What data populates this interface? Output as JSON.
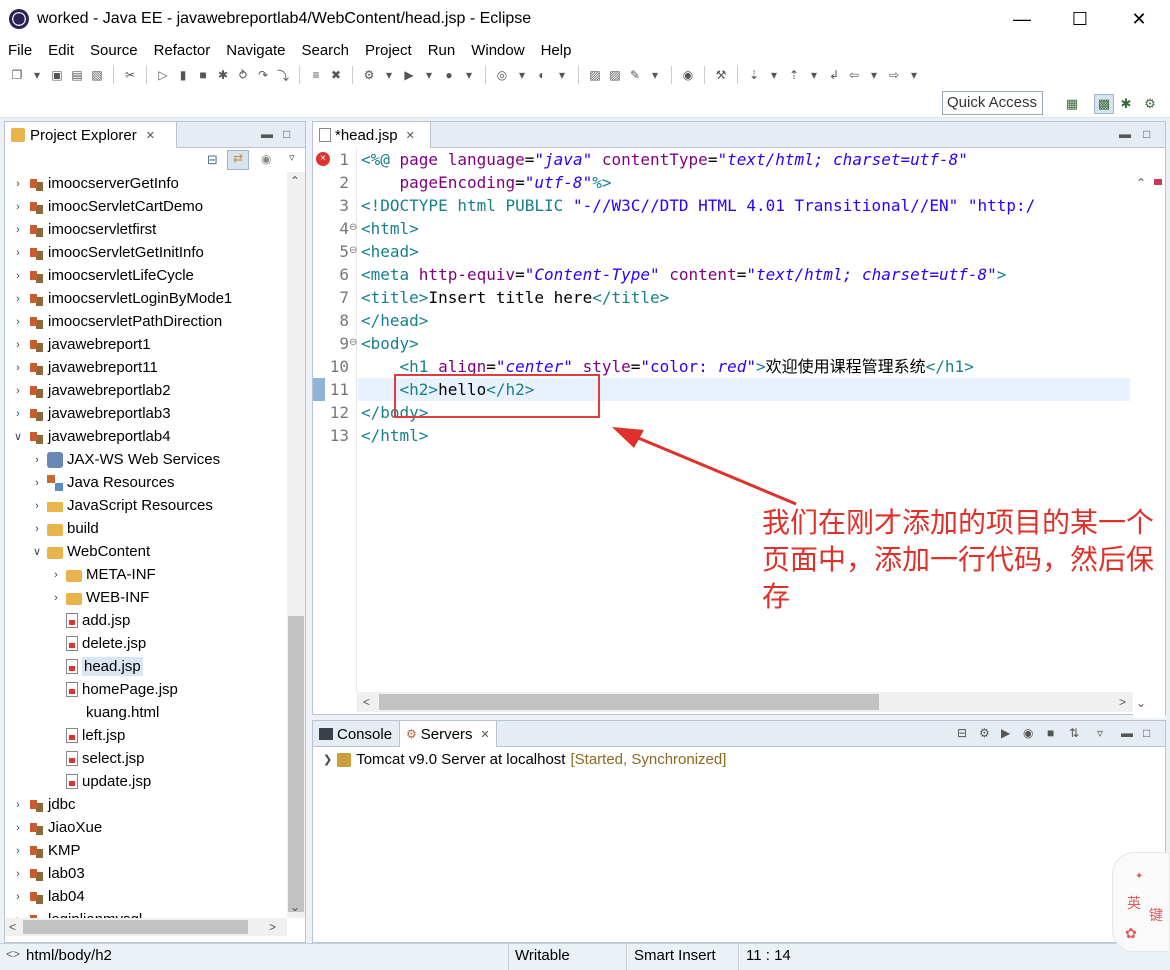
{
  "window": {
    "title": "worked - Java EE - javawebreportlab4/WebContent/head.jsp - Eclipse",
    "minimize": "—",
    "maximize": "☐",
    "close": "✕"
  },
  "menu": [
    "File",
    "Edit",
    "Source",
    "Refactor",
    "Navigate",
    "Search",
    "Project",
    "Run",
    "Window",
    "Help"
  ],
  "toolbar": {
    "quick_access": "Quick Access"
  },
  "project_explorer": {
    "tab_label": "Project Explorer",
    "tab_close": "✕",
    "items": [
      {
        "label": "imoocserverGetInfo",
        "type": "proj",
        "level": 0,
        "expanded": false
      },
      {
        "label": "imoocServletCartDemo",
        "type": "proj",
        "level": 0,
        "expanded": false
      },
      {
        "label": "imoocservletfirst",
        "type": "proj",
        "level": 0,
        "expanded": false
      },
      {
        "label": "imoocServletGetInitInfo",
        "type": "proj",
        "level": 0,
        "expanded": false
      },
      {
        "label": "imoocservletLifeCycle",
        "type": "proj",
        "level": 0,
        "expanded": false
      },
      {
        "label": "imoocservletLoginByMode1",
        "type": "proj",
        "level": 0,
        "expanded": false
      },
      {
        "label": "imoocservletPathDirection",
        "type": "proj",
        "level": 0,
        "expanded": false
      },
      {
        "label": "javawebreport1",
        "type": "proj",
        "level": 0,
        "expanded": false
      },
      {
        "label": "javawebreport11",
        "type": "proj",
        "level": 0,
        "expanded": false
      },
      {
        "label": "javawebreportlab2",
        "type": "proj",
        "level": 0,
        "expanded": false
      },
      {
        "label": "javawebreportlab3",
        "type": "proj",
        "level": 0,
        "expanded": false
      },
      {
        "label": "javawebreportlab4",
        "type": "proj",
        "level": 0,
        "expanded": true
      },
      {
        "label": "JAX-WS Web Services",
        "type": "jaxws",
        "level": 1,
        "expanded": false
      },
      {
        "label": "Java Resources",
        "type": "jres",
        "level": 1,
        "expanded": false
      },
      {
        "label": "JavaScript Resources",
        "type": "jsres",
        "level": 1,
        "expanded": false
      },
      {
        "label": "build",
        "type": "folder",
        "level": 1,
        "expanded": false
      },
      {
        "label": "WebContent",
        "type": "folder",
        "level": 1,
        "expanded": true
      },
      {
        "label": "META-INF",
        "type": "folder",
        "level": 2,
        "expanded": false
      },
      {
        "label": "WEB-INF",
        "type": "folder",
        "level": 2,
        "expanded": false
      },
      {
        "label": "add.jsp",
        "type": "file",
        "level": 2,
        "leaf": true
      },
      {
        "label": "delete.jsp",
        "type": "file",
        "level": 2,
        "leaf": true
      },
      {
        "label": "head.jsp",
        "type": "file",
        "level": 2,
        "leaf": true,
        "selected": true
      },
      {
        "label": "homePage.jsp",
        "type": "file",
        "level": 2,
        "leaf": true
      },
      {
        "label": "kuang.html",
        "type": "html",
        "level": 2,
        "leaf": true
      },
      {
        "label": "left.jsp",
        "type": "file",
        "level": 2,
        "leaf": true
      },
      {
        "label": "select.jsp",
        "type": "file",
        "level": 2,
        "leaf": true
      },
      {
        "label": "update.jsp",
        "type": "file",
        "level": 2,
        "leaf": true
      },
      {
        "label": "jdbc",
        "type": "proj",
        "level": 0,
        "expanded": false
      },
      {
        "label": "JiaoXue",
        "type": "proj",
        "level": 0,
        "expanded": false
      },
      {
        "label": "KMP",
        "type": "proj",
        "level": 0,
        "expanded": false
      },
      {
        "label": "lab03",
        "type": "proj",
        "level": 0,
        "expanded": false
      },
      {
        "label": "lab04",
        "type": "proj",
        "level": 0,
        "expanded": false
      },
      {
        "label": "loginlianmysql",
        "type": "proj",
        "level": 0,
        "expanded": false
      }
    ]
  },
  "editor": {
    "tab_label": "*head.jsp",
    "tab_close": "✕",
    "line_numbers": [
      "1",
      "2",
      "3",
      "4",
      "5",
      "6",
      "7",
      "8",
      "9",
      "10",
      "11",
      "12",
      "13"
    ],
    "lines": [
      [
        [
          "tag",
          "<%@ "
        ],
        [
          "attr",
          "page "
        ],
        [
          "attr",
          "language"
        ],
        [
          "txt",
          "="
        ],
        [
          "str",
          "\"java\""
        ],
        [
          "txt",
          " "
        ],
        [
          "attr",
          "contentType"
        ],
        [
          "txt",
          "="
        ],
        [
          "str",
          "\"text/html; charset=utf-8\""
        ]
      ],
      [
        [
          "txt",
          "    "
        ],
        [
          "attr",
          "pageEncoding"
        ],
        [
          "txt",
          "="
        ],
        [
          "str",
          "\"utf-8\""
        ],
        [
          "tag",
          "%>"
        ]
      ],
      [
        [
          "tag",
          "<!DOCTYPE "
        ],
        [
          "kw",
          "html "
        ],
        [
          "dt",
          "PUBLIC "
        ],
        [
          "plainstr",
          "\"-//W3C//DTD HTML 4.01 Transitional//EN\" \"http:/"
        ]
      ],
      [
        [
          "tag",
          "<html>"
        ]
      ],
      [
        [
          "tag",
          "<head>"
        ]
      ],
      [
        [
          "tag",
          "<meta "
        ],
        [
          "attr",
          "http-equiv"
        ],
        [
          "txt",
          "="
        ],
        [
          "str",
          "\"Content-Type\""
        ],
        [
          "txt",
          " "
        ],
        [
          "attr",
          "content"
        ],
        [
          "txt",
          "="
        ],
        [
          "str",
          "\"text/html; charset=utf-8\""
        ],
        [
          "tag",
          ">"
        ]
      ],
      [
        [
          "tag",
          "<title>"
        ],
        [
          "txt",
          "Insert title here"
        ],
        [
          "tag",
          "</title>"
        ]
      ],
      [
        [
          "tag",
          "</head>"
        ]
      ],
      [
        [
          "tag",
          "<body>"
        ]
      ],
      [
        [
          "txt",
          "    "
        ],
        [
          "tag",
          "<h1 "
        ],
        [
          "attr",
          "align"
        ],
        [
          "txt",
          "="
        ],
        [
          "str",
          "\"center\""
        ],
        [
          "txt",
          " "
        ],
        [
          "attr",
          "style"
        ],
        [
          "txt",
          "="
        ],
        [
          "plainstr",
          "\"color: "
        ],
        [
          "str",
          "red"
        ],
        [
          "plainstr",
          "\""
        ],
        [
          "tag",
          ">"
        ],
        [
          "txt",
          "欢迎使用课程管理系统"
        ],
        [
          "tag",
          "</h1>"
        ]
      ],
      [
        [
          "txt",
          "    "
        ],
        [
          "tag",
          "<h2>"
        ],
        [
          "txt",
          "hello"
        ],
        [
          "tag",
          "</h2>"
        ]
      ],
      [
        [
          "tag",
          "</body>"
        ]
      ],
      [
        [
          "tag",
          "</html>"
        ]
      ]
    ]
  },
  "annotation": {
    "text": "我们在刚才添加的项目的某一个页面中，添加一行代码，然后保存"
  },
  "bottom_panel": {
    "tabs": [
      "Console",
      "Servers"
    ],
    "active_tab": "Servers",
    "tab_close": "✕",
    "server_name": "Tomcat v9.0 Server at localhost",
    "server_status": "[Started, Synchronized]"
  },
  "statusbar": {
    "path": "html/body/h2",
    "mode": "Writable",
    "insert": "Smart Insert",
    "position": "11 : 14"
  },
  "ime": {
    "label1": "英",
    "label2": "键"
  },
  "colors": {
    "annotation": "#e0302a",
    "tag": "#17808c",
    "attr": "#7f007f",
    "string": "#2a00ff"
  }
}
